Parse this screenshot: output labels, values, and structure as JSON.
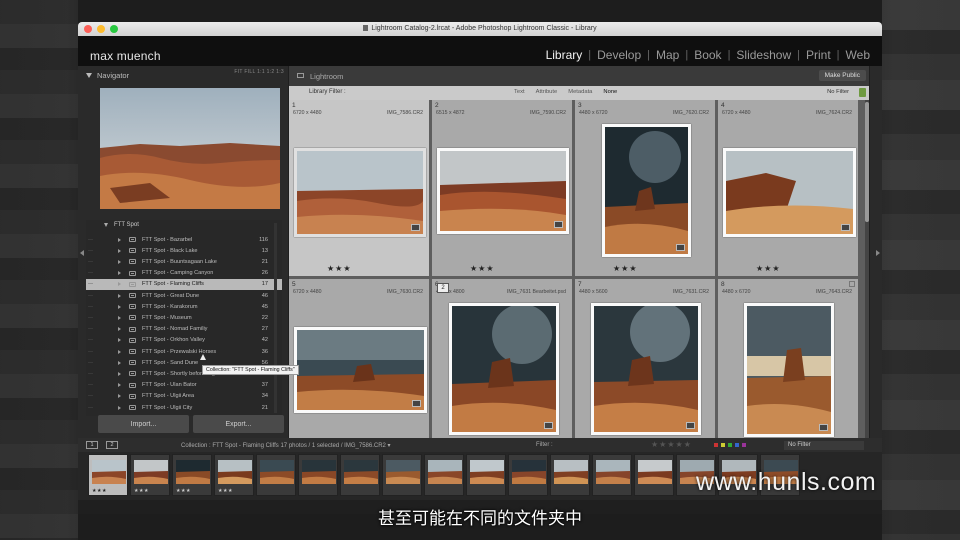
{
  "window": {
    "title": "Lightroom Catalog-2.lrcat - Adobe Photoshop Lightroom Classic - Library"
  },
  "identity": {
    "brand": "max muench",
    "modules": [
      "Library",
      "Develop",
      "Map",
      "Book",
      "Slideshow",
      "Print",
      "Web"
    ],
    "active_module": "Library"
  },
  "navigator": {
    "title": "Navigator",
    "zoom_options": "FIT  FILL  1:1  1:2  1:3"
  },
  "collections": {
    "root": "FTT Spot",
    "items": [
      {
        "label": "FTT Spot - Bazarbel",
        "count": "116"
      },
      {
        "label": "FTT Spot - Black Lake",
        "count": "13"
      },
      {
        "label": "FTT Spot - Buuntsagaan Lake",
        "count": "21"
      },
      {
        "label": "FTT Spot - Camping Canyon",
        "count": "26"
      },
      {
        "label": "FTT Spot - Flaming Cliffs",
        "count": "17"
      },
      {
        "label": "FTT Spot - Great Dune",
        "count": "46"
      },
      {
        "label": "FTT Spot - Karakorum",
        "count": "45"
      },
      {
        "label": "FTT Spot - Museum",
        "count": "22"
      },
      {
        "label": "FTT Spot - Nomad Familiy",
        "count": "27"
      },
      {
        "label": "FTT Spot - Orkhon Valley",
        "count": "42"
      },
      {
        "label": "FTT Spot - Przewalski Horses",
        "count": "36"
      },
      {
        "label": "FTT Spot - Sand Dune",
        "count": "56"
      },
      {
        "label": "FTT Spot - Shortly before Ulgii",
        "count": "41"
      },
      {
        "label": "FTT Spot - Ulan Bator",
        "count": "37"
      },
      {
        "label": "FTT Spot - Ulgii Area",
        "count": "34"
      },
      {
        "label": "FTT Spot - Ulgii City",
        "count": "21"
      }
    ],
    "selected_index": 4,
    "tooltip": "Collection: \"FTT Spot - Flaming Cliffs\""
  },
  "buttons": {
    "import": "Import...",
    "export": "Export..."
  },
  "center": {
    "title": "Lightroom",
    "make_public": "Make Public"
  },
  "filter": {
    "label": "Library Filter :",
    "options": [
      "Text",
      "Attribute",
      "Metadata",
      "None"
    ],
    "active": "None",
    "preset": "No Filter"
  },
  "grid": [
    {
      "num": "1",
      "dims": "6720 x 4480",
      "file": "IMG_7586.CR2",
      "stars": "★★★"
    },
    {
      "num": "2",
      "dims": "6515 x 4872",
      "file": "IMG_7590.CR2",
      "stars": "★★★"
    },
    {
      "num": "3",
      "dims": "4480 x 6720",
      "file": "IMG_7620.CR2",
      "stars": "★★★"
    },
    {
      "num": "4",
      "dims": "6720 x 4480",
      "file": "IMG_7624.CR2",
      "stars": "★★★"
    },
    {
      "num": "5",
      "dims": "6720 x 4480",
      "file": "IMG_7630.CR2",
      "stars": ""
    },
    {
      "num": "6",
      "dims": "4480 x 4800",
      "file": "IMG_7631 Bearbeitet.psd",
      "stars": "",
      "stack": "2"
    },
    {
      "num": "7",
      "dims": "4480 x 5600",
      "file": "IMG_7631.CR2",
      "stars": ""
    },
    {
      "num": "8",
      "dims": "4480 x 6720",
      "file": "IMG_7643.CR2",
      "stars": ""
    }
  ],
  "filmbar": {
    "screen1": "1",
    "screen2": "2",
    "path": "Collection : FTT Spot - Flaming Cliffs     17 photos / 1 selected / IMG_7586.CR2 ▾",
    "filter_label": "Filter :",
    "stars": "★★★★★",
    "preset": "No Filter"
  },
  "colors": {
    "selected_row": "#b9b9b9",
    "grid_bg": "#5e5e5e",
    "cell_bg": "#a9a9a9",
    "lock": "#6f9a41"
  },
  "watermark": "www.hunls.com",
  "subtitle": "甚至可能在不同的文件夹中"
}
